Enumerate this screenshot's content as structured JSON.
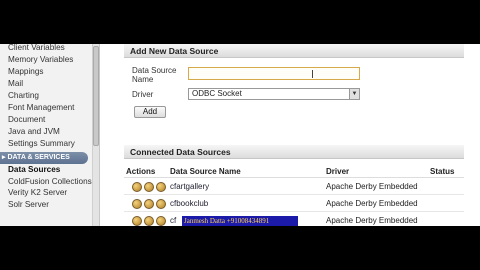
{
  "sidebar": {
    "items_top": [
      {
        "label": "Client Variables"
      },
      {
        "label": "Memory Variables"
      },
      {
        "label": "Mappings"
      },
      {
        "label": "Mail"
      },
      {
        "label": "Charting"
      },
      {
        "label": "Font Management"
      },
      {
        "label": "Document"
      },
      {
        "label": "Java and JVM"
      },
      {
        "label": "Settings Summary"
      }
    ],
    "section": "DATA & SERVICES",
    "items_bottom": [
      {
        "label": "Data Sources"
      },
      {
        "label": "ColdFusion Collections"
      },
      {
        "label": "Verity K2 Server"
      },
      {
        "label": "Solr Server"
      }
    ]
  },
  "add_panel": {
    "title": "Add New Data Source",
    "name_label": "Data Source Name",
    "name_value": "",
    "driver_label": "Driver",
    "driver_value": "ODBC Socket",
    "add_label": "Add"
  },
  "connected": {
    "title": "Connected Data Sources",
    "columns": {
      "actions": "Actions",
      "name": "Data Source Name",
      "driver": "Driver",
      "status": "Status"
    },
    "rows": [
      {
        "name": "cfartgallery",
        "driver": "Apache Derby Embedded"
      },
      {
        "name": "cfbookclub",
        "driver": "Apache Derby Embedded"
      },
      {
        "name": "cf",
        "driver": "Apache Derby Embedded"
      }
    ]
  },
  "watermark": "Janmesh Datta +91008434891",
  "colors": {
    "input_border": "#d6a94a",
    "section_bg": "#5d7191",
    "action_icon": "#b07f23"
  }
}
